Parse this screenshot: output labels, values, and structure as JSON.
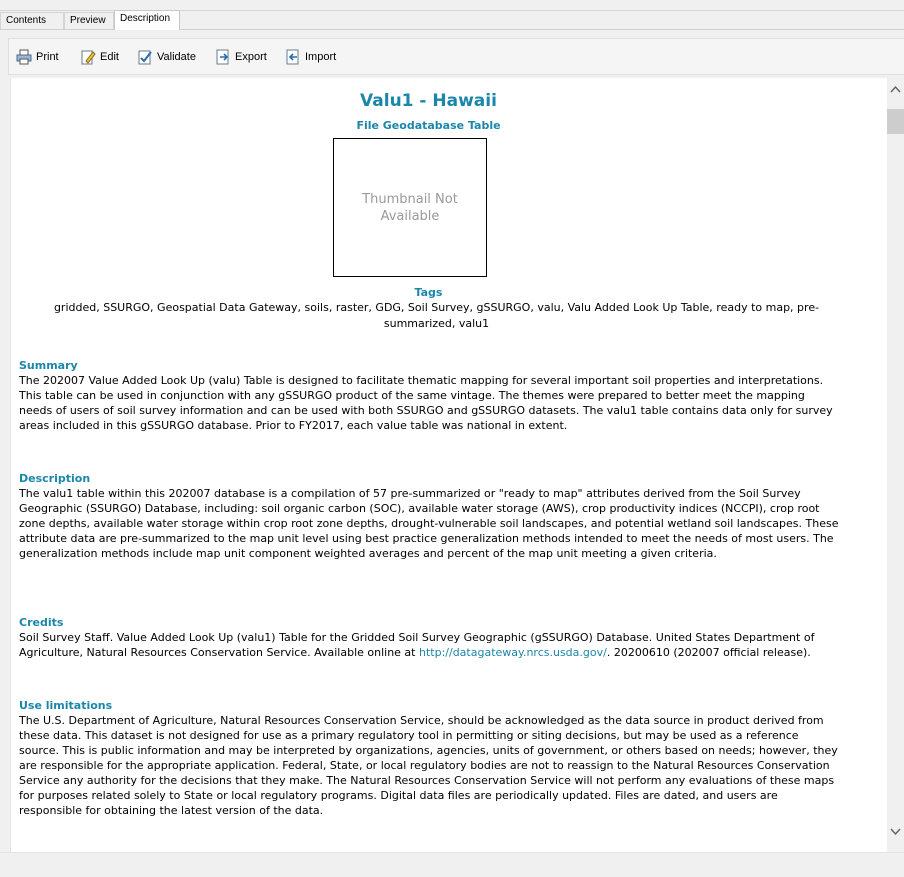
{
  "tabs": [
    "Contents",
    "Preview",
    "Description"
  ],
  "toolbar": {
    "print": "Print",
    "edit": "Edit",
    "validate": "Validate",
    "export": "Export",
    "import": "Import"
  },
  "doc": {
    "title": "Valu1 - Hawaii",
    "subtitle": "File Geodatabase Table",
    "thumbnail_line1": "Thumbnail Not",
    "thumbnail_line2": "Available",
    "tags_heading": "Tags",
    "tags": "gridded, SSURGO, Geospatial Data Gateway, soils, raster, GDG, Soil Survey, gSSURGO, valu, Valu Added Look Up Table, ready to map, pre-summarized, valu1",
    "summary_heading": "Summary",
    "summary": "The 202007 Value Added Look Up (valu) Table is designed to facilitate thematic mapping for several important soil properties and interpretations. This table can be used in conjunction with any gSSURGO product of the same vintage. The themes were prepared to better meet the mapping needs of users of soil survey information and can be used with both SSURGO and gSSURGO datasets. The valu1 table contains data only for survey areas included in this gSSURGO database. Prior to FY2017, each value table was national in extent.",
    "description_heading": "Description",
    "description": "The valu1 table within this 202007 database is a compilation of 57 pre-summarized or \"ready to map\" attributes derived from the Soil Survey Geographic (SSURGO) Database, including: soil organic carbon (SOC), available water storage (AWS), crop productivity indices (NCCPI), crop root zone depths, available water storage within crop root zone depths, drought-vulnerable soil landscapes, and potential wetland soil landscapes. These attribute data are pre-summarized to the map unit level using best practice generalization methods intended to meet the needs of most users. The generalization methods include map unit component weighted averages and percent of the map unit meeting a given criteria.",
    "credits_heading": "Credits",
    "credits_pre": "Soil Survey Staff. Value Added Look Up (valu1) Table for the Gridded Soil Survey Geographic (gSSURGO) Database. United States Department of Agriculture, Natural Resources Conservation Service. Available online at ",
    "credits_link": "http://datagateway.nrcs.usda.gov/",
    "credits_post": ". 20200610 (202007 official release).",
    "use_heading": "Use limitations",
    "use_limitations": "The U.S. Department of Agriculture, Natural Resources Conservation Service, should be acknowledged as the data source in product derived from these data. This dataset is not designed for use as a primary regulatory tool in permitting or siting decisions, but may be used as a reference source. This is public information and may be interpreted by organizations, agencies, units of government, or others based on needs; however, they are responsible for the appropriate application. Federal, State, or local regulatory bodies are not to reassign to the Natural Resources Conservation Service any authority for the decisions that they make. The Natural Resources Conservation Service will not perform any evaluations of these maps for purposes related solely to State or local regulatory programs. Digital data files are periodically updated. Files are dated, and users are responsible for obtaining the latest version of the data."
  },
  "colors": {
    "heading": "#1b87a8",
    "link": "#1b87a8"
  },
  "icons": [
    "printer-icon",
    "edit-icon",
    "validate-icon",
    "export-icon",
    "import-icon",
    "scroll-up-icon",
    "scroll-down-icon"
  ]
}
